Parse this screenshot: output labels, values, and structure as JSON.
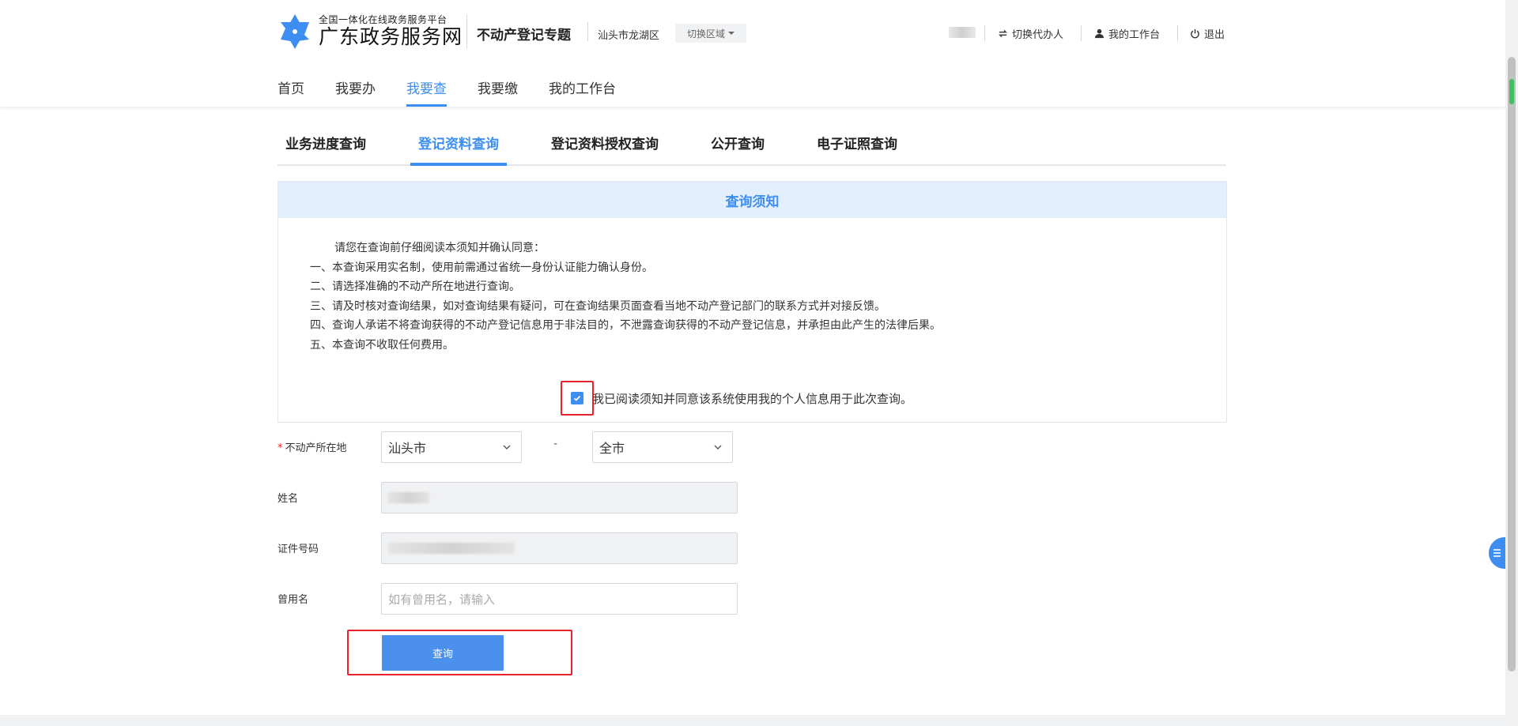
{
  "header": {
    "logo_sub": "全国一体化在线政务服务平台",
    "logo_main": "广东政务服务网",
    "topic": "不动产登记专题",
    "region": "汕头市龙湖区",
    "switch_region": "切换区域",
    "links": {
      "switch_agent": "切换代办人",
      "workbench": "我的工作台",
      "logout": "退出"
    }
  },
  "main_nav": [
    "首页",
    "我要办",
    "我要查",
    "我要缴",
    "我的工作台"
  ],
  "sub_tabs": [
    "业务进度查询",
    "登记资料查询",
    "登记资料授权查询",
    "公开查询",
    "电子证照查询"
  ],
  "notice": {
    "title": "查询须知",
    "intro": "请您在查询前仔细阅读本须知并确认同意：",
    "items": [
      "一、本查询采用实名制，使用前需通过省统一身份认证能力确认身份。",
      "二、请选择准确的不动产所在地进行查询。",
      "三、请及时核对查询结果，如对查询结果有疑问，可在查询结果页面查看当地不动产登记部门的联系方式并对接反馈。",
      "四、查询人承诺不将查询获得的不动产登记信息用于非法目的，不泄露查询获得的不动产登记信息，并承担由此产生的法律后果。",
      "五、本查询不收取任何费用。"
    ],
    "agree_text": "我已阅读须知并同意该系统使用我的个人信息用于此次查询。",
    "agree_checked": true
  },
  "form": {
    "location_label": "不动产所在地",
    "required_mark": "*",
    "city_value": "汕头市",
    "district_value": "全市",
    "separator": "-",
    "name_label": "姓名",
    "id_label": "证件号码",
    "alias_label": "曾用名",
    "alias_placeholder": "如有曾用名，请输入",
    "submit_label": "查询"
  },
  "colors": {
    "accent": "#3d8ef0",
    "highlight_frame": "#e8232c",
    "notice_head_bg": "#e3effd"
  }
}
